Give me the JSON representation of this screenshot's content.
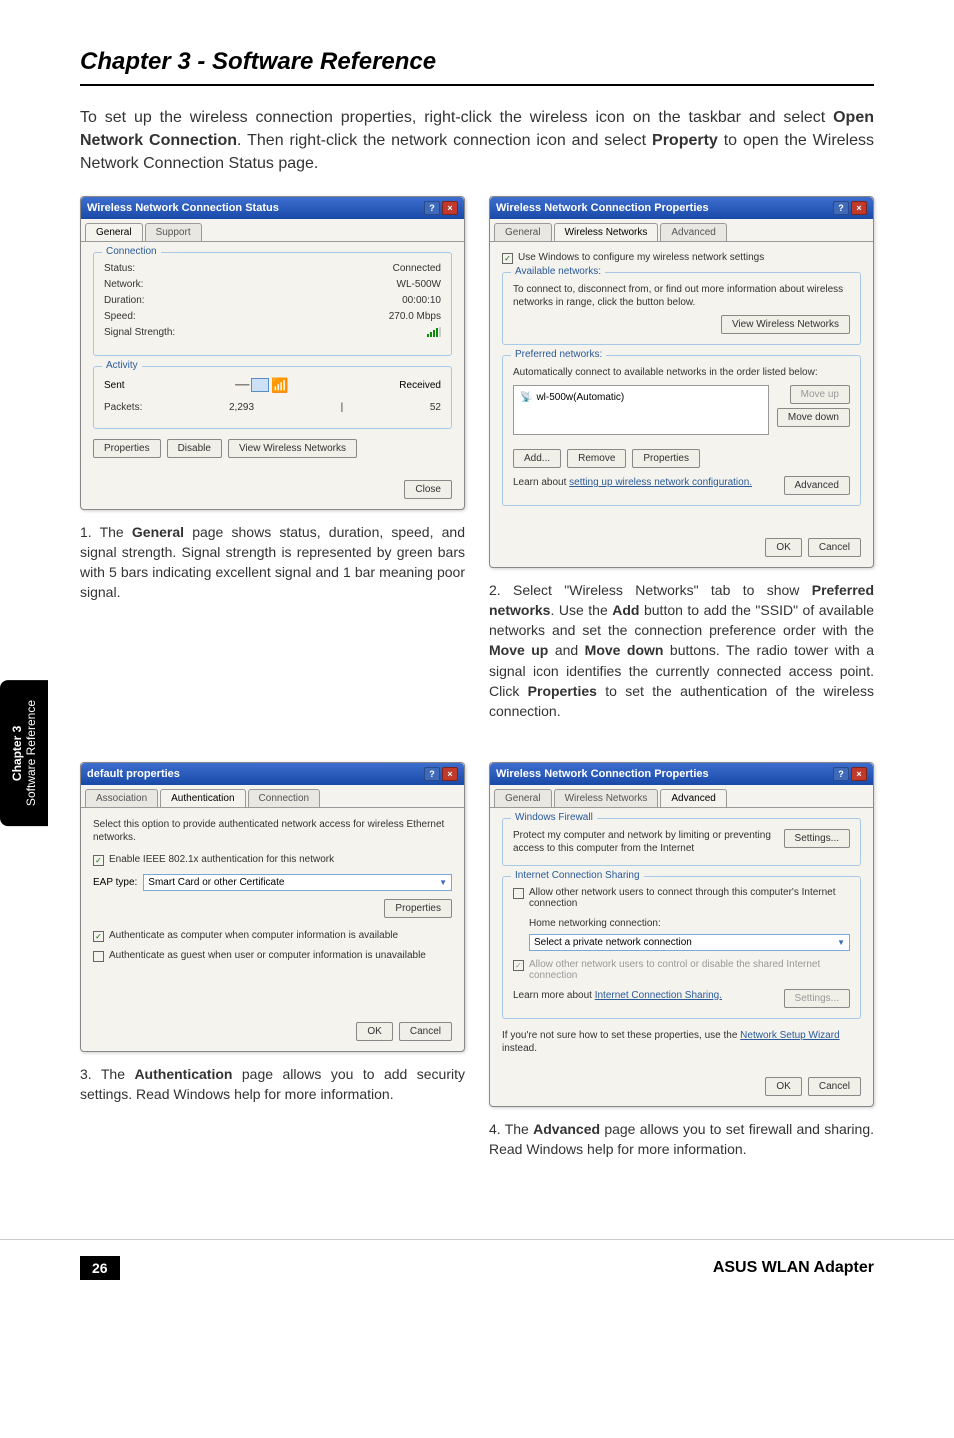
{
  "section_title": "Chapter 3 - Software Reference",
  "intro_parts": {
    "p1": "To set up the wireless connection properties, right-click the wireless icon on the taskbar and select ",
    "b1": "Open Network Connection",
    "p2": ". Then right-click the network connection icon and select ",
    "b2": "Property",
    "p3": " to open the Wireless Network Connection Status page."
  },
  "dialog1": {
    "title": "Wireless Network Connection Status",
    "tabs": [
      "General",
      "Support"
    ],
    "connection": {
      "label": "Connection",
      "status_label": "Status:",
      "status_value": "Connected",
      "network_label": "Network:",
      "network_value": "WL-500W",
      "duration_label": "Duration:",
      "duration_value": "00:00:10",
      "speed_label": "Speed:",
      "speed_value": "270.0 Mbps",
      "signal_label": "Signal Strength:"
    },
    "activity": {
      "label": "Activity",
      "sent": "Sent",
      "received": "Received",
      "packets_label": "Packets:",
      "packets_sent": "2,293",
      "packets_received": "52"
    },
    "buttons": {
      "properties": "Properties",
      "disable": "Disable",
      "view": "View Wireless Networks",
      "close": "Close"
    }
  },
  "caption1_parts": {
    "prefix": "1. The ",
    "b1": "General",
    "rest": " page shows status, duration, speed, and signal strength. Signal strength is represented by green bars with 5 bars indicating excellent signal and 1 bar meaning poor signal."
  },
  "dialog2": {
    "title": "Wireless Network Connection Properties",
    "tabs": [
      "General",
      "Wireless Networks",
      "Advanced"
    ],
    "use_windows": "Use Windows to configure my wireless network settings",
    "available": {
      "label": "Available networks:",
      "text": "To connect to, disconnect from, or find out more information about wireless networks in range, click the button below.",
      "button": "View Wireless Networks"
    },
    "preferred": {
      "label": "Preferred networks:",
      "text": "Automatically connect to available networks in the order listed below:",
      "item": "wl-500w(Automatic)",
      "move_up": "Move up",
      "move_down": "Move down",
      "add": "Add...",
      "remove": "Remove",
      "properties": "Properties"
    },
    "learn": "Learn about ",
    "learn_link": "setting up wireless network configuration.",
    "advanced": "Advanced",
    "ok": "OK",
    "cancel": "Cancel"
  },
  "caption2_parts": {
    "prefix": "2. Select \"Wireless Networks\" tab to show ",
    "b1": "Preferred networks",
    "p2": ". Use the ",
    "b2": "Add",
    "p3": " button to add the \"SSID\" of available networks and set the connection preference order with the ",
    "b3": "Move up",
    "p4": " and ",
    "b4": "Move down",
    "p5": " buttons. The radio tower with a signal icon identifies the currently connected access point. Click ",
    "b5": "Properties",
    "p6": " to set the authentication of the wireless connection."
  },
  "dialog3": {
    "title": "default properties",
    "tabs": [
      "Association",
      "Authentication",
      "Connection"
    ],
    "text1": "Select this option to provide authenticated network access for wireless Ethernet networks.",
    "check1": "Enable IEEE 802.1x authentication for this network",
    "eap_label": "EAP type:",
    "eap_value": "Smart Card or other Certificate",
    "properties": "Properties",
    "check2": "Authenticate as computer when computer information is available",
    "check3": "Authenticate as guest when user or computer information is unavailable",
    "ok": "OK",
    "cancel": "Cancel"
  },
  "caption3_parts": {
    "prefix": "3. The ",
    "b1": "Authentication",
    "rest": " page allows you to add security settings. Read Windows help for more information."
  },
  "dialog4": {
    "title": "Wireless Network Connection Properties",
    "tabs": [
      "General",
      "Wireless Networks",
      "Advanced"
    ],
    "firewall": {
      "label": "Windows Firewall",
      "text": "Protect my computer and network by limiting or preventing access to this computer from the Internet",
      "button": "Settings..."
    },
    "ics": {
      "label": "Internet Connection Sharing",
      "check1": "Allow other network users to connect through this computer's Internet connection",
      "home_label": "Home networking connection:",
      "home_value": "Select a private network connection",
      "check2": "Allow other network users to control or disable the shared Internet connection",
      "learn": "Learn more about ",
      "learn_link": "Internet Connection Sharing.",
      "settings": "Settings..."
    },
    "wizard_text": "If you're not sure how to set these properties, use the ",
    "wizard_link": "Network Setup Wizard",
    "wizard_suffix": " instead.",
    "ok": "OK",
    "cancel": "Cancel"
  },
  "caption4_parts": {
    "prefix": "4. The ",
    "b1": "Advanced",
    "rest": " page allows you to set firewall and sharing. Read Windows help for more information."
  },
  "sidebar": {
    "line1": "Chapter 3",
    "line2": "Software Reference"
  },
  "footer": {
    "page": "26",
    "product": "ASUS WLAN Adapter"
  }
}
